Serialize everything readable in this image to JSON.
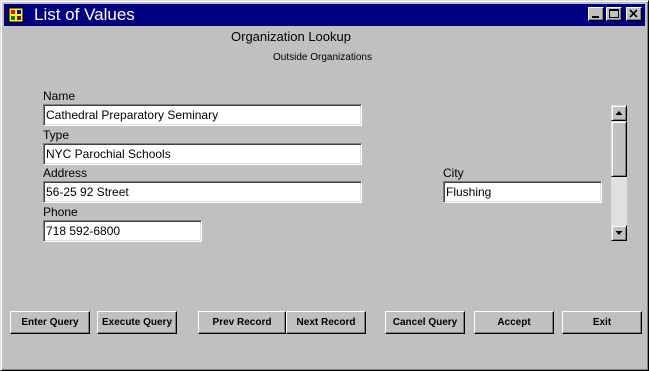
{
  "window": {
    "title": "List of Values",
    "icon": "app-icon"
  },
  "header": {
    "title": "Organization Lookup",
    "subtitle": "Outside Organizations"
  },
  "fields": {
    "name": {
      "label": "Name",
      "value": "Cathedral Preparatory Seminary"
    },
    "type": {
      "label": "Type",
      "value": "NYC Parochial Schools"
    },
    "address": {
      "label": "Address",
      "value": "56-25 92 Street"
    },
    "phone": {
      "label": "Phone",
      "value": "718 592-6800"
    },
    "city": {
      "label": "City",
      "value": "Flushing"
    }
  },
  "buttons": {
    "enter_query": "Enter Query",
    "execute_query": "Execute Query",
    "prev_record": "Prev Record",
    "next_record": "Next Record",
    "cancel_query": "Cancel Query",
    "accept": "Accept",
    "exit": "Exit"
  },
  "colors": {
    "titlebar": "#000080",
    "face": "#c0c0c0",
    "field": "#ffffff"
  }
}
